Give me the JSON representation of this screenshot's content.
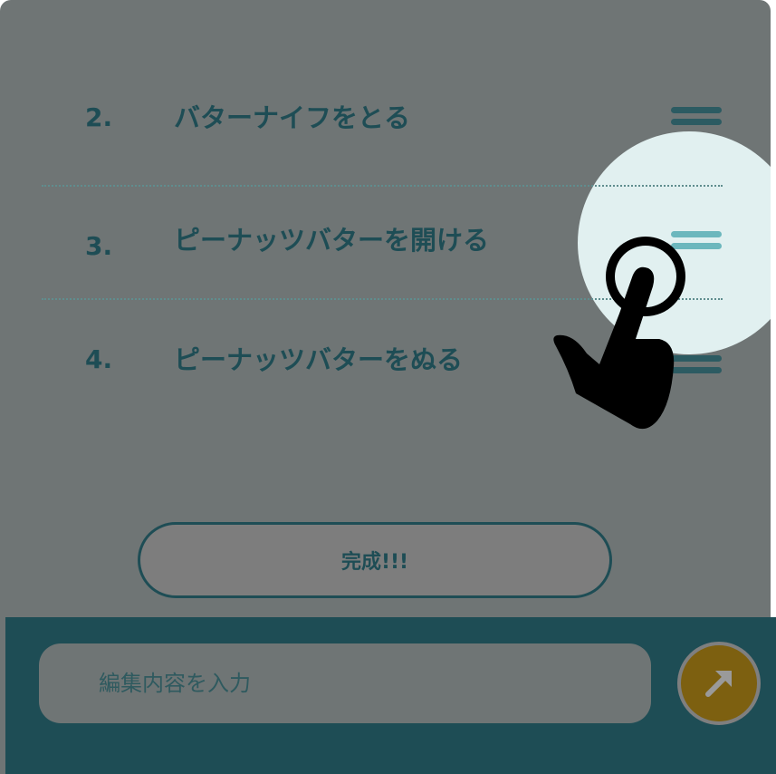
{
  "steps": [
    {
      "number": "2.",
      "text": "バターナイフをとる"
    },
    {
      "number": "3.",
      "text": "ピーナッツバターを開ける"
    },
    {
      "number": "4.",
      "text": "ピーナッツバターをぬる"
    }
  ],
  "actions": {
    "done_label": "完成!!!"
  },
  "editor": {
    "placeholder": "編集内容を入力"
  },
  "icons": {
    "drag_handle": "drag-handle-icon",
    "send": "arrow-up-right-icon",
    "tutorial_pointer": "tap-hand-icon"
  },
  "colors": {
    "overlay": "#6f7575",
    "primary": "#1e4d55",
    "spotlight": "#e1f0f0",
    "send_button": "#7d6010",
    "active_handle": "#6cb7bd"
  }
}
